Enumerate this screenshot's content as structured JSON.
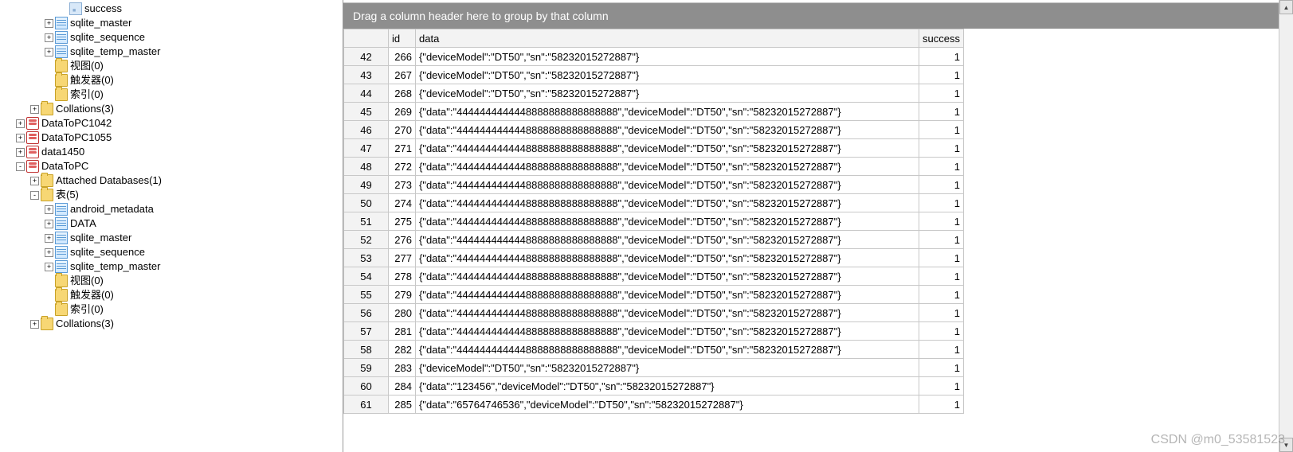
{
  "tree": [
    {
      "indent": 4,
      "exp": "none",
      "icon": "col",
      "label": "success"
    },
    {
      "indent": 3,
      "exp": "+",
      "icon": "table",
      "label": "sqlite_master"
    },
    {
      "indent": 3,
      "exp": "+",
      "icon": "table",
      "label": "sqlite_sequence"
    },
    {
      "indent": 3,
      "exp": "+",
      "icon": "table",
      "label": "sqlite_temp_master"
    },
    {
      "indent": 3,
      "exp": "none",
      "icon": "folder",
      "label": "视图(0)"
    },
    {
      "indent": 3,
      "exp": "none",
      "icon": "folder",
      "label": "触发器(0)"
    },
    {
      "indent": 3,
      "exp": "none",
      "icon": "folder",
      "label": "索引(0)"
    },
    {
      "indent": 2,
      "exp": "+",
      "icon": "folder",
      "label": "Collations(3)"
    },
    {
      "indent": 1,
      "exp": "+",
      "icon": "db",
      "label": "DataToPC1042"
    },
    {
      "indent": 1,
      "exp": "+",
      "icon": "db",
      "label": "DataToPC1055"
    },
    {
      "indent": 1,
      "exp": "+",
      "icon": "db",
      "label": "data1450"
    },
    {
      "indent": 1,
      "exp": "-",
      "icon": "db",
      "label": "DataToPC"
    },
    {
      "indent": 2,
      "exp": "+",
      "icon": "folder",
      "label": "Attached Databases(1)"
    },
    {
      "indent": 2,
      "exp": "-",
      "icon": "folder",
      "label": "表(5)"
    },
    {
      "indent": 3,
      "exp": "+",
      "icon": "table",
      "label": "android_metadata"
    },
    {
      "indent": 3,
      "exp": "+",
      "icon": "table",
      "label": "DATA"
    },
    {
      "indent": 3,
      "exp": "+",
      "icon": "table",
      "label": "sqlite_master"
    },
    {
      "indent": 3,
      "exp": "+",
      "icon": "table",
      "label": "sqlite_sequence"
    },
    {
      "indent": 3,
      "exp": "+",
      "icon": "table",
      "label": "sqlite_temp_master"
    },
    {
      "indent": 3,
      "exp": "none",
      "icon": "folder",
      "label": "视图(0)"
    },
    {
      "indent": 3,
      "exp": "none",
      "icon": "folder",
      "label": "触发器(0)"
    },
    {
      "indent": 3,
      "exp": "none",
      "icon": "folder",
      "label": "索引(0)"
    },
    {
      "indent": 2,
      "exp": "+",
      "icon": "folder",
      "label": "Collations(3)"
    }
  ],
  "groupBarText": "Drag a column header here to group by that column",
  "columns": {
    "rownum": "",
    "id": "id",
    "data": "data",
    "success": "success"
  },
  "rows": [
    {
      "n": 42,
      "id": 266,
      "data": "{\"deviceModel\":\"DT50\",\"sn\":\"58232015272887\"}",
      "success": 1
    },
    {
      "n": 43,
      "id": 267,
      "data": "{\"deviceModel\":\"DT50\",\"sn\":\"58232015272887\"}",
      "success": 1
    },
    {
      "n": 44,
      "id": 268,
      "data": "{\"deviceModel\":\"DT50\",\"sn\":\"58232015272887\"}",
      "success": 1
    },
    {
      "n": 45,
      "id": 269,
      "data": "{\"data\":\"4444444444448888888888888888\",\"deviceModel\":\"DT50\",\"sn\":\"58232015272887\"}",
      "success": 1
    },
    {
      "n": 46,
      "id": 270,
      "data": "{\"data\":\"4444444444448888888888888888\",\"deviceModel\":\"DT50\",\"sn\":\"58232015272887\"}",
      "success": 1
    },
    {
      "n": 47,
      "id": 271,
      "data": "{\"data\":\"4444444444448888888888888888\",\"deviceModel\":\"DT50\",\"sn\":\"58232015272887\"}",
      "success": 1
    },
    {
      "n": 48,
      "id": 272,
      "data": "{\"data\":\"4444444444448888888888888888\",\"deviceModel\":\"DT50\",\"sn\":\"58232015272887\"}",
      "success": 1
    },
    {
      "n": 49,
      "id": 273,
      "data": "{\"data\":\"4444444444448888888888888888\",\"deviceModel\":\"DT50\",\"sn\":\"58232015272887\"}",
      "success": 1
    },
    {
      "n": 50,
      "id": 274,
      "data": "{\"data\":\"4444444444448888888888888888\",\"deviceModel\":\"DT50\",\"sn\":\"58232015272887\"}",
      "success": 1
    },
    {
      "n": 51,
      "id": 275,
      "data": "{\"data\":\"4444444444448888888888888888\",\"deviceModel\":\"DT50\",\"sn\":\"58232015272887\"}",
      "success": 1
    },
    {
      "n": 52,
      "id": 276,
      "data": "{\"data\":\"4444444444448888888888888888\",\"deviceModel\":\"DT50\",\"sn\":\"58232015272887\"}",
      "success": 1
    },
    {
      "n": 53,
      "id": 277,
      "data": "{\"data\":\"4444444444448888888888888888\",\"deviceModel\":\"DT50\",\"sn\":\"58232015272887\"}",
      "success": 1
    },
    {
      "n": 54,
      "id": 278,
      "data": "{\"data\":\"4444444444448888888888888888\",\"deviceModel\":\"DT50\",\"sn\":\"58232015272887\"}",
      "success": 1
    },
    {
      "n": 55,
      "id": 279,
      "data": "{\"data\":\"4444444444448888888888888888\",\"deviceModel\":\"DT50\",\"sn\":\"58232015272887\"}",
      "success": 1
    },
    {
      "n": 56,
      "id": 280,
      "data": "{\"data\":\"4444444444448888888888888888\",\"deviceModel\":\"DT50\",\"sn\":\"58232015272887\"}",
      "success": 1
    },
    {
      "n": 57,
      "id": 281,
      "data": "{\"data\":\"4444444444448888888888888888\",\"deviceModel\":\"DT50\",\"sn\":\"58232015272887\"}",
      "success": 1
    },
    {
      "n": 58,
      "id": 282,
      "data": "{\"data\":\"4444444444448888888888888888\",\"deviceModel\":\"DT50\",\"sn\":\"58232015272887\"}",
      "success": 1
    },
    {
      "n": 59,
      "id": 283,
      "data": "{\"deviceModel\":\"DT50\",\"sn\":\"58232015272887\"}",
      "success": 1
    },
    {
      "n": 60,
      "id": 284,
      "data": "{\"data\":\"123456\",\"deviceModel\":\"DT50\",\"sn\":\"58232015272887\"}",
      "success": 1
    },
    {
      "n": 61,
      "id": 285,
      "data": "{\"data\":\"65764746536\",\"deviceModel\":\"DT50\",\"sn\":\"58232015272887\"}",
      "success": 1
    }
  ],
  "watermark": "CSDN @m0_53581523"
}
